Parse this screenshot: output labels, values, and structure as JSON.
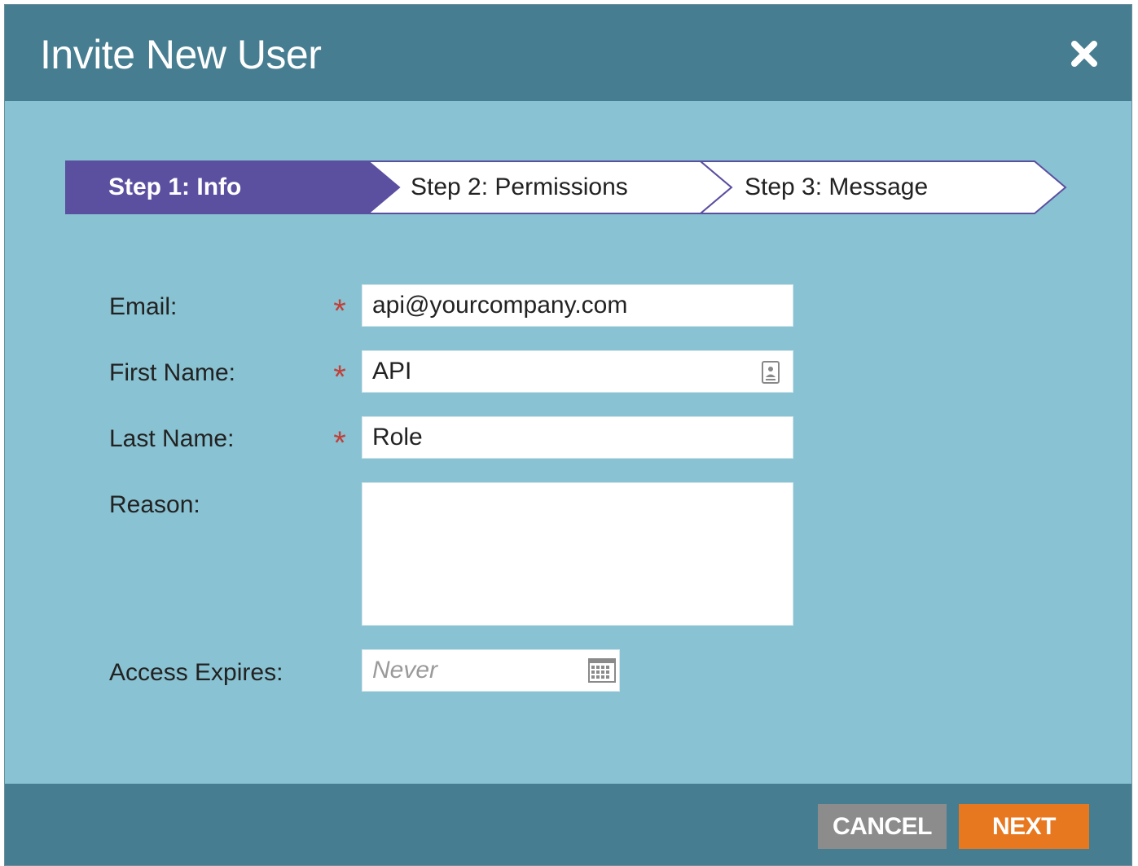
{
  "dialog": {
    "title": "Invite New User",
    "close_icon": "close-icon"
  },
  "steps": [
    {
      "label": "Step 1: Info",
      "active": true
    },
    {
      "label": "Step 2: Permissions",
      "active": false
    },
    {
      "label": "Step 3: Message",
      "active": false
    }
  ],
  "form": {
    "email": {
      "label": "Email:",
      "required_mark": "*",
      "value": "api@yourcompany.com"
    },
    "first_name": {
      "label": "First Name:",
      "required_mark": "*",
      "value": "API",
      "icon": "contact-card-icon"
    },
    "last_name": {
      "label": "Last Name:",
      "required_mark": "*",
      "value": "Role"
    },
    "reason": {
      "label": "Reason:",
      "value": ""
    },
    "access_expires": {
      "label": "Access Expires:",
      "placeholder": "Never",
      "icon": "calendar-icon"
    }
  },
  "footer": {
    "cancel_label": "CANCEL",
    "next_label": "NEXT"
  },
  "colors": {
    "header": "#467d90",
    "body": "#89c2d2",
    "step_active": "#5b4fa0",
    "step_border": "#5b4fa0",
    "required": "#c0413a",
    "cancel": "#8c8c8c",
    "next": "#e8781f"
  }
}
